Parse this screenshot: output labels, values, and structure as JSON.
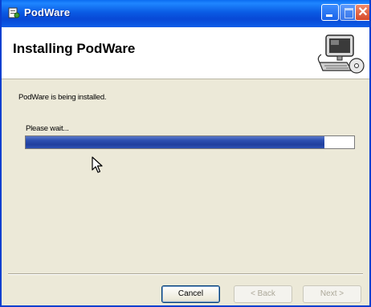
{
  "window": {
    "title": "PodWare",
    "icon": "installer-icon",
    "controls": [
      "minimize-icon",
      "maximize-icon",
      "close-icon"
    ],
    "close_glyph": "✕"
  },
  "header": {
    "title": "Installing PodWare",
    "art": "computer-install-illustration"
  },
  "body": {
    "status": "PodWare is being installed.",
    "wait_label": "Please wait...",
    "progress_fraction": 0.91
  },
  "buttons": {
    "cancel": "Cancel",
    "back": "< Back",
    "next": "Next >"
  },
  "colors": {
    "titlebar": "#0a5be4",
    "progress": "#203f9e",
    "window_bg": "#ece9d8"
  }
}
